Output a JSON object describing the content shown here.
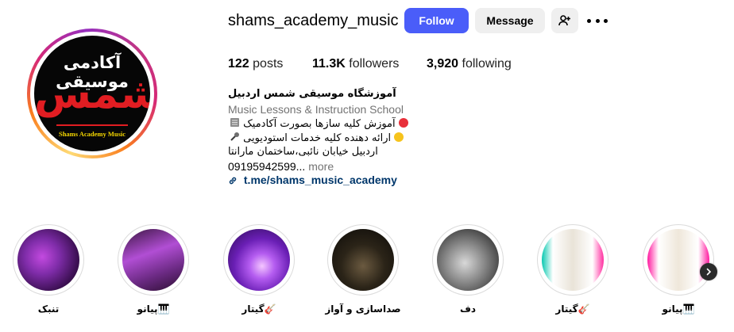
{
  "profile": {
    "username": "shams_academy_music",
    "avatar": {
      "top_text": "آکادمی موسیقی",
      "main_text": "شمس",
      "sub_text": "Shams Academy Music"
    }
  },
  "actions": {
    "follow_label": "Follow",
    "message_label": "Message",
    "add_user_icon": "person-add-icon",
    "more_icon": "more-horizontal-icon"
  },
  "stats": {
    "posts_count": "122",
    "posts_label": "posts",
    "followers_count": "11.3K",
    "followers_label": "followers",
    "following_count": "3,920",
    "following_label": "following"
  },
  "bio": {
    "name": "آموزشگاه موسیقی شمس اردبیل",
    "category": "Music Lessons & Instruction School",
    "line1": "آموزش کلیه سازها بصورت آکادمیک",
    "line2": "ارائه دهنده کلیه خدمات استودیویی",
    "line3": "اردبیل خیابان نائبی،ساختمان مارانتا",
    "line4": "09195942599...",
    "more_label": "more",
    "link": "t.me/shams_music_academy"
  },
  "highlights": [
    {
      "label": "تنبک"
    },
    {
      "label": "پیانو🎹"
    },
    {
      "label": "گیتار🎸"
    },
    {
      "label": "صداسازی و آواز"
    },
    {
      "label": "دف"
    },
    {
      "label": "گیتار🎸"
    },
    {
      "label": "پیانو🎹"
    }
  ],
  "colors": {
    "follow_button": "#4a5df9",
    "secondary_button": "#efefef",
    "link": "#00376b",
    "muted_text": "#737373"
  }
}
